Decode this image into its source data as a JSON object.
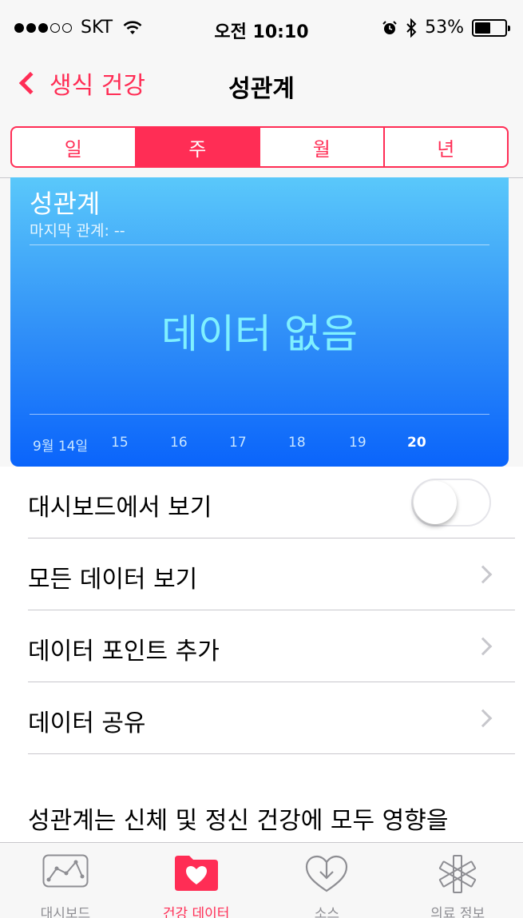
{
  "status_bar": {
    "carrier": "SKT",
    "time": "오전 10:10",
    "battery": "53%",
    "battery_level": 0.53
  },
  "nav": {
    "back_label": "생식 건강",
    "title": "성관계"
  },
  "segments": [
    {
      "label": "일",
      "active": false
    },
    {
      "label": "주",
      "active": true
    },
    {
      "label": "월",
      "active": false
    },
    {
      "label": "년",
      "active": false
    }
  ],
  "card": {
    "title": "성관계",
    "subtitle": "마지막 관계: --",
    "empty_message": "데이터 없음",
    "x_labels": [
      "9월 14일",
      "15",
      "16",
      "17",
      "18",
      "19",
      "20"
    ],
    "current_label": "20"
  },
  "list": {
    "dashboard_toggle_label": "대시보드에서 보기",
    "dashboard_toggle_on": false,
    "all_data_label": "모든 데이터 보기",
    "add_data_label": "데이터 포인트 추가",
    "share_data_label": "데이터 공유",
    "description": "성관계는 신체 및 정신 건강에 모두 영향을"
  },
  "tabs": [
    {
      "label": "대시보드",
      "icon": "dashboard-icon",
      "active": false
    },
    {
      "label": "건강 데이터",
      "icon": "health-data-icon",
      "active": true
    },
    {
      "label": "소스",
      "icon": "sources-icon",
      "active": false
    },
    {
      "label": "의료 정보",
      "icon": "medical-id-icon",
      "active": false
    }
  ],
  "colors": {
    "accent": "#ff2d55",
    "card_top": "#5ac8fa",
    "card_bottom": "#0a64fb"
  }
}
